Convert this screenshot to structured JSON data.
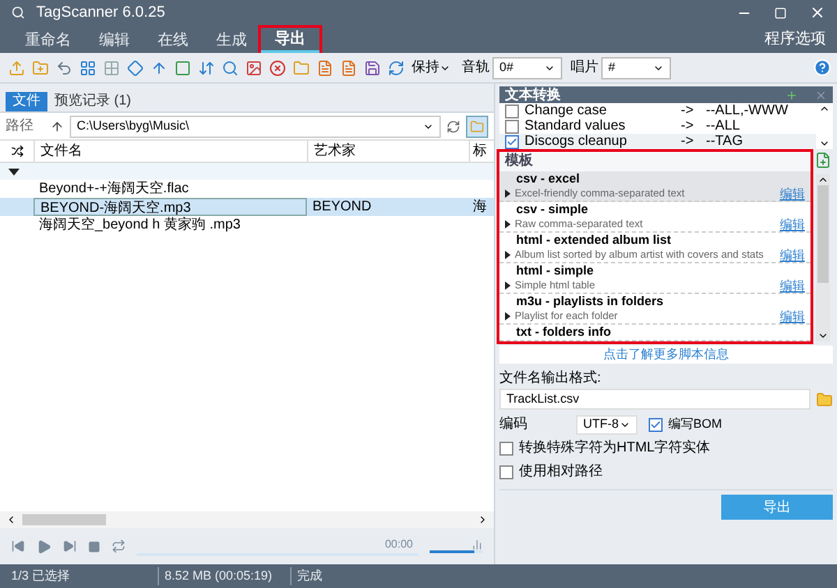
{
  "window": {
    "title": "TagScanner 6.0.25"
  },
  "menu_tabs": [
    {
      "label": "重命名",
      "selected": false
    },
    {
      "label": "编辑",
      "selected": false
    },
    {
      "label": "在线",
      "selected": false
    },
    {
      "label": "生成",
      "selected": false
    },
    {
      "label": "导出",
      "selected": true
    }
  ],
  "options_label": "程序选项",
  "toolbar": {
    "keep_label": "保持",
    "track_label": "音轨",
    "track_value": "0#",
    "disc_label": "唱片",
    "disc_value": "#"
  },
  "file_panel": {
    "tabs": [
      {
        "label": "文件",
        "selected": true
      },
      {
        "label": "预览记录 (1)",
        "selected": false
      }
    ],
    "path_label": "路径",
    "path_value": "C:\\Users\\byg\\Music\\",
    "columns": [
      "文件名",
      "艺术家",
      "标"
    ],
    "rows": [
      {
        "filename": "Beyond+-+海阔天空.flac",
        "artist": "",
        "column_3": "",
        "selected": false
      },
      {
        "filename": "BEYOND-海阔天空.mp3",
        "artist": "BEYOND",
        "column_3": "海",
        "selected": true
      },
      {
        "filename": "海阔天空_beyond h 黄家驹 .mp3",
        "artist": "",
        "column_3": "",
        "selected": false
      }
    ],
    "time": "00:00",
    "volume": {
      "level": 0.85
    }
  },
  "text_conversion": {
    "title": "文本转换",
    "items": [
      {
        "name": "Change case",
        "arrow": "->",
        "target": "--ALL,-WWW",
        "checked": false
      },
      {
        "name": "Standard values",
        "arrow": "->",
        "target": "--ALL",
        "checked": false
      },
      {
        "name": "Discogs cleanup",
        "arrow": "->",
        "target": "--TAG",
        "checked": true
      }
    ]
  },
  "templates": {
    "title": "模板",
    "items": [
      {
        "title": "csv - excel",
        "description": "Excel-friendly comma-separated text",
        "edit": "编辑",
        "selected": true
      },
      {
        "title": "csv - simple",
        "description": "Raw comma-separated text",
        "edit": "编辑",
        "selected": false
      },
      {
        "title": "html - extended album list",
        "description": "Album list sorted by album artist with covers and stats",
        "edit": "编辑",
        "selected": false
      },
      {
        "title": "html - simple",
        "description": "Simple html table",
        "edit": "编辑",
        "selected": false
      },
      {
        "title": "m3u - playlists in folders",
        "description": "Playlist for each folder",
        "edit": "编辑",
        "selected": false
      },
      {
        "title": "txt - folders info",
        "selected": false
      }
    ],
    "more_info": "点击了解更多脚本信息"
  },
  "output": {
    "format_label": "文件名输出格式:",
    "format_value": "TrackList.csv",
    "encoding_label": "编码",
    "encoding_value": "UTF-8",
    "write_bom": {
      "label": "编写BOM",
      "checked": true
    },
    "options": [
      {
        "label": "转换特殊字符为HTML字符实体",
        "checked": false
      },
      {
        "label": "使用相对路径",
        "checked": false
      }
    ],
    "export_button": "导出"
  },
  "status_bar": [
    "1/3 已选择",
    "8.52 MB (00:05:19)",
    "完成"
  ]
}
